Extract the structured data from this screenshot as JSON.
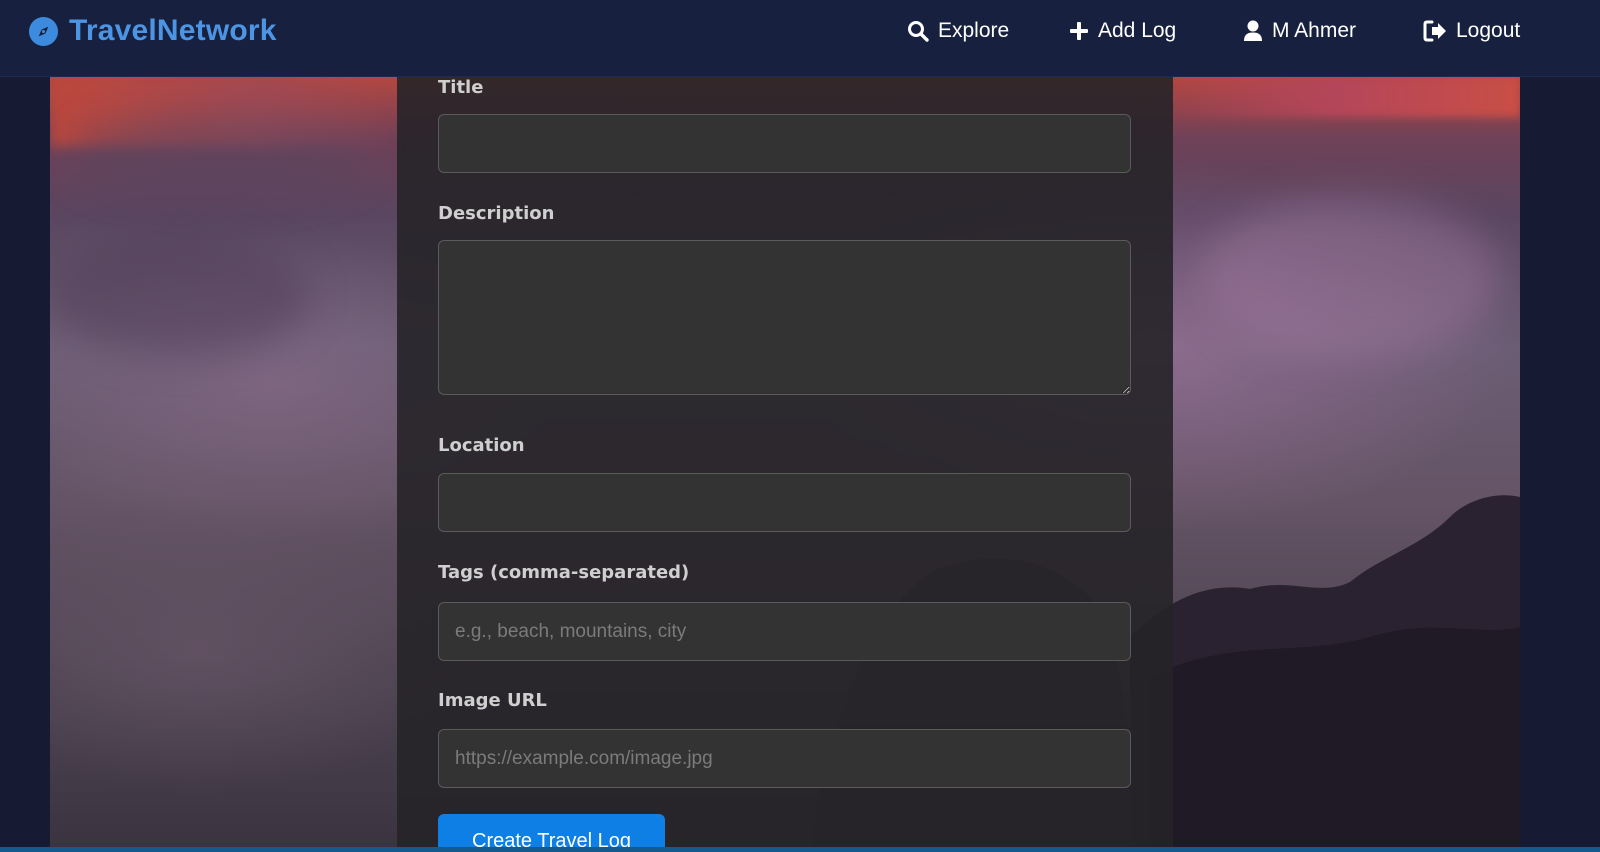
{
  "brand": {
    "name": "TravelNetwork",
    "color": "#4c95e4",
    "icon": "compass-icon"
  },
  "nav": {
    "items": [
      {
        "label": "Explore",
        "icon": "search-icon"
      },
      {
        "label": "Add Log",
        "icon": "plus-icon"
      },
      {
        "label": "M Ahmer",
        "icon": "user-icon"
      },
      {
        "label": "Logout",
        "icon": "logout-icon"
      }
    ]
  },
  "form": {
    "fields": {
      "title": {
        "label": "Title",
        "value": "",
        "placeholder": ""
      },
      "description": {
        "label": "Description",
        "value": "",
        "placeholder": ""
      },
      "location": {
        "label": "Location",
        "value": "",
        "placeholder": ""
      },
      "tags": {
        "label": "Tags (comma-separated)",
        "value": "",
        "placeholder": "e.g., beach, mountains, city"
      },
      "image_url": {
        "label": "Image URL",
        "value": "",
        "placeholder": "https://example.com/image.jpg"
      }
    },
    "submit_label": "Create Travel Log"
  },
  "colors": {
    "navbar": "#17213f",
    "page_background": "#171a33",
    "primary_button": "#0e7fe4",
    "input_background": "#333333"
  }
}
